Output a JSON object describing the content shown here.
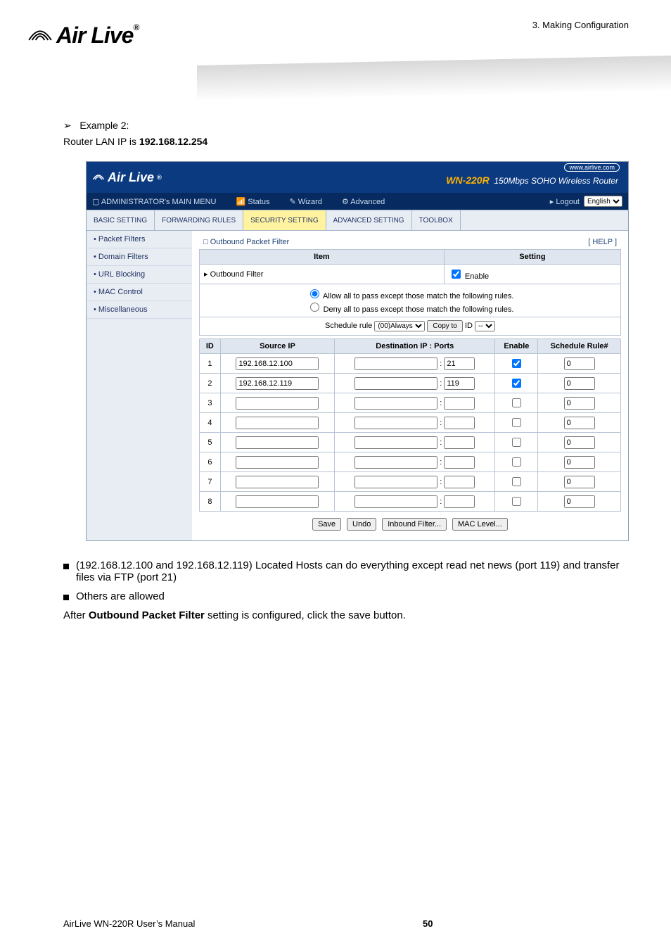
{
  "header": {
    "chapter": "3. Making Configuration",
    "logo_text": "Air Live"
  },
  "example": {
    "arrow": "➢",
    "label": "Example 2:"
  },
  "lan_line": {
    "prefix": "Router LAN IP is ",
    "ip": "192.168.12.254"
  },
  "shot": {
    "brand": "Air Live",
    "wn_url": "www.airlive.com",
    "prod_model": "WN-220R",
    "prod_desc": "150Mbps SOHO Wireless Router",
    "menu": {
      "main": "ADMINISTRATOR's MAIN MENU",
      "status": "Status",
      "wizard": "Wizard",
      "advanced": "Advanced",
      "logout": "▸ Logout",
      "lang": "English"
    },
    "tabs": {
      "basic": "BASIC SETTING",
      "forward": "FORWARDING RULES",
      "security": "SECURITY SETTING",
      "advsetting": "ADVANCED SETTING",
      "toolbox": "TOOLBOX"
    },
    "side": {
      "packet": "• Packet Filters",
      "domain": "• Domain Filters",
      "url": "• URL Blocking",
      "mac": "• MAC Control",
      "misc": "• Miscellaneous"
    },
    "panel_title": "□ Outbound Packet Filter",
    "help": "[ HELP ]",
    "item_h": "Item",
    "setting_h": "Setting",
    "outfilter": "▸ Outbound Filter",
    "enable": "Enable",
    "allow": "Allow all to pass except those match the following rules.",
    "deny": "Deny all to pass except those match the following rules.",
    "sched_label": "Schedule rule",
    "sched_opt": "(00)Always",
    "copyto": "Copy to",
    "idlabel": "ID",
    "iddash": "--",
    "th_id": "ID",
    "th_src": "Source IP",
    "th_dst": "Destination IP : Ports",
    "th_en": "Enable",
    "th_sr": "Schedule Rule#",
    "rows": [
      {
        "id": "1",
        "src": "192.168.12.100",
        "dst": "",
        "port": "21",
        "en": true,
        "sr": "0"
      },
      {
        "id": "2",
        "src": "192.168.12.119",
        "dst": "",
        "port": "119",
        "en": true,
        "sr": "0"
      },
      {
        "id": "3",
        "src": "",
        "dst": "",
        "port": "",
        "en": false,
        "sr": "0"
      },
      {
        "id": "4",
        "src": "",
        "dst": "",
        "port": "",
        "en": false,
        "sr": "0"
      },
      {
        "id": "5",
        "src": "",
        "dst": "",
        "port": "",
        "en": false,
        "sr": "0"
      },
      {
        "id": "6",
        "src": "",
        "dst": "",
        "port": "",
        "en": false,
        "sr": "0"
      },
      {
        "id": "7",
        "src": "",
        "dst": "",
        "port": "",
        "en": false,
        "sr": "0"
      },
      {
        "id": "8",
        "src": "",
        "dst": "",
        "port": "",
        "en": false,
        "sr": "0"
      }
    ],
    "btn_save": "Save",
    "btn_undo": "Undo",
    "btn_in": "Inbound Filter...",
    "btn_mac": "MAC Level..."
  },
  "bullets": {
    "b1": "(192.168.12.100 and 192.168.12.119) Located Hosts can do everything except read net news (port 119) and transfer files via FTP (port 21)",
    "b2": "Others are allowed"
  },
  "after": {
    "pre": "After ",
    "bold": "Outbound Packet Filter",
    "post": " setting is configured, click the save button."
  },
  "footer": {
    "left": "AirLive WN-220R User’s Manual",
    "page": "50"
  }
}
